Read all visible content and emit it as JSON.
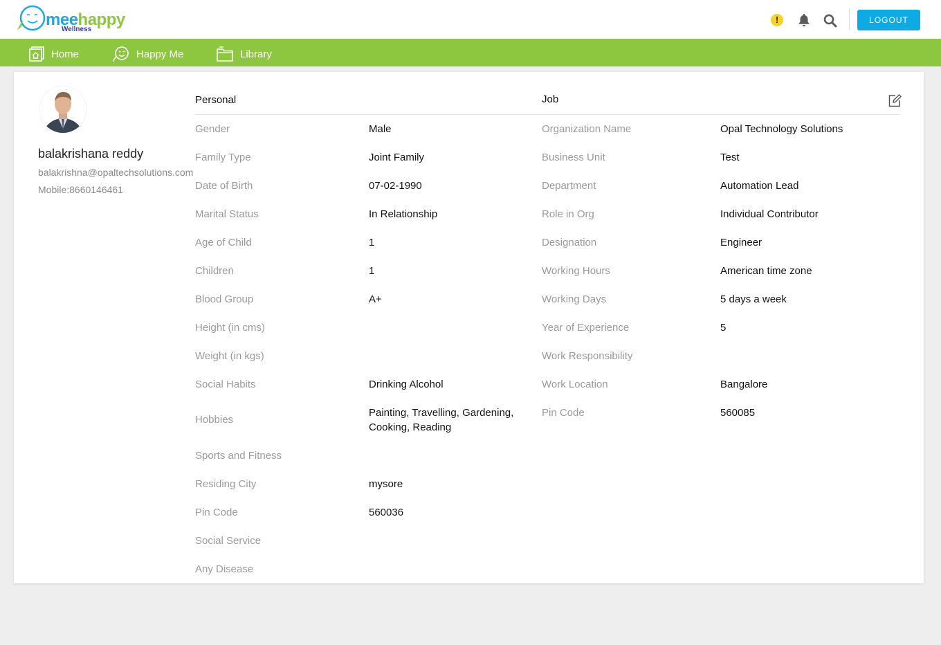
{
  "header": {
    "logo": {
      "brand_part1": "mee",
      "brand_part2": "happy",
      "tagline": "Wellness"
    },
    "alert_symbol": "!",
    "logout_label": "LOGOUT",
    "icons": [
      "alert-icon",
      "bell-icon",
      "search-icon"
    ]
  },
  "nav": {
    "items": [
      {
        "label": "Home",
        "icon": "home-icon"
      },
      {
        "label": "Happy Me",
        "icon": "smiley-icon"
      },
      {
        "label": "Library",
        "icon": "folder-icon"
      }
    ]
  },
  "profile": {
    "name": "balakrishana reddy",
    "email": "balakrishna@opaltechsolutions.com",
    "mobile": "Mobile:8660146461"
  },
  "sections": {
    "personal": "Personal",
    "job": "Job"
  },
  "personal": [
    {
      "label": "Gender",
      "value": "Male"
    },
    {
      "label": "Family Type",
      "value": "Joint Family"
    },
    {
      "label": "Date of Birth",
      "value": "07-02-1990"
    },
    {
      "label": "Marital Status",
      "value": "In Relationship"
    },
    {
      "label": "Age of Child",
      "value": "1"
    },
    {
      "label": "Children",
      "value": "1"
    },
    {
      "label": "Blood Group",
      "value": "A+"
    },
    {
      "label": "Height (in cms)",
      "value": ""
    },
    {
      "label": "Weight (in kgs)",
      "value": ""
    },
    {
      "label": "Social Habits",
      "value": "Drinking Alcohol"
    },
    {
      "label": "Hobbies",
      "value": "Painting, Travelling, Gardening, Cooking, Reading"
    },
    {
      "label": "Sports and Fitness",
      "value": ""
    },
    {
      "label": "Residing City",
      "value": "mysore"
    },
    {
      "label": "Pin Code",
      "value": "560036"
    },
    {
      "label": "Social Service",
      "value": ""
    },
    {
      "label": "Any Disease",
      "value": ""
    }
  ],
  "job": [
    {
      "label": "Organization Name",
      "value": "Opal Technology Solutions"
    },
    {
      "label": "Business Unit",
      "value": "Test"
    },
    {
      "label": "Department",
      "value": "Automation Lead"
    },
    {
      "label": "Role in Org",
      "value": "Individual Contributor"
    },
    {
      "label": "Designation",
      "value": "Engineer"
    },
    {
      "label": "Working Hours",
      "value": "American time zone"
    },
    {
      "label": "Working Days",
      "value": "5 days a week"
    },
    {
      "label": "Year of Experience",
      "value": "5"
    },
    {
      "label": "Work Responsibility",
      "value": ""
    },
    {
      "label": "Work Location",
      "value": "Bangalore"
    },
    {
      "label": "Pin Code",
      "value": "560085"
    }
  ]
}
